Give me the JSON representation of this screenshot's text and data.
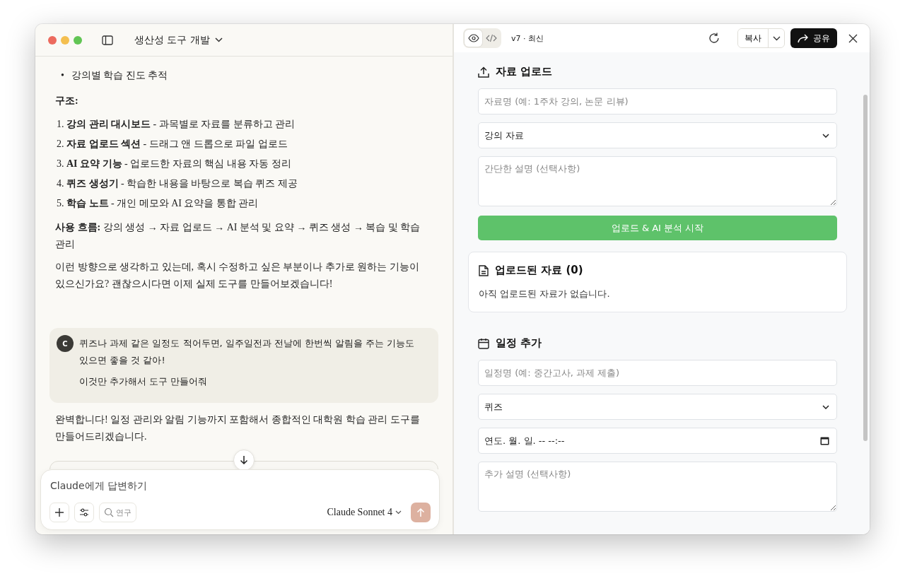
{
  "window": {
    "title": "생산성 도구 개발"
  },
  "chat": {
    "bullets": [
      {
        "marker": "•",
        "text": "강의별 학습 진도 추적"
      }
    ],
    "structure_heading": "구조:",
    "steps": [
      "1. **강의 관리 대시보드** - 과목별로 자료를 분류하고 관리",
      "2. **자료 업로드 섹션** - 드래그 앤 드롭으로 파일 업로드",
      "3. **AI 요약 기능** - 업로드한 자료의 핵심 내용 자동 정리",
      "4. **퀴즈 생성기** - 학습한 내용을 바탕으로 복습 퀴즈 제공",
      "5. **학습 노트** - 개인 메모와 AI 요약을 통합 관리"
    ],
    "flow": "**사용 흐름:** 강의 생성 → 자료 업로드 → AI 분석 및 요약 → 퀴즈 생성 → 복습 및 학습 관리",
    "question": "이런 방향으로 생각하고 있는데, 혹시 수정하고 싶은 부분이나 추가로 원하는 기능이 있으신가요? 괜찮으시다면 이제 실제 도구를 만들어보겠습니다!",
    "user_message": {
      "avatar": "C",
      "paragraphs": [
        "퀴즈나 과제 같은 일정도 적어두면, 일주일전과 전날에 한번씩 알림을 주는 기능도 있으면 좋을 것 같아!",
        "이것만 추가해서 도구 만들어줘"
      ]
    },
    "reply": "완벽합니다! 일정 관리와 알림 기능까지 포함해서 종합적인 대학원 학습 관리 도구를 만들어드리겠습니다.",
    "composer": {
      "placeholder": "Claude에게 답변하기",
      "research_label": "연구",
      "model": "Claude Sonnet 4"
    }
  },
  "artifact": {
    "view_tabs": [
      {
        "kind": "preview",
        "selected": true
      },
      {
        "kind": "code",
        "selected": false
      }
    ],
    "version": "v7 · 최신",
    "copy": "복사",
    "share": "공유",
    "upload": {
      "title": "자료 업로드",
      "name_placeholder": "자료명 (예: 1주차 강의, 논문 리뷰)",
      "category": "강의 자료",
      "desc_placeholder": "간단한 설명 (선택사항)",
      "button": "업로드 & AI 분석 시작"
    },
    "uploaded": {
      "title": "업로드된 자료 (0)",
      "empty": "아직 업로드된 자료가 없습니다."
    },
    "schedule": {
      "title": "일정 추가",
      "name_placeholder": "일정명 (예: 중간고사, 과제 제출)",
      "type": "퀴즈",
      "datetime": "연도. 월. 일. -- --:--",
      "desc_placeholder": "추가 설명 (선택사항)"
    }
  }
}
